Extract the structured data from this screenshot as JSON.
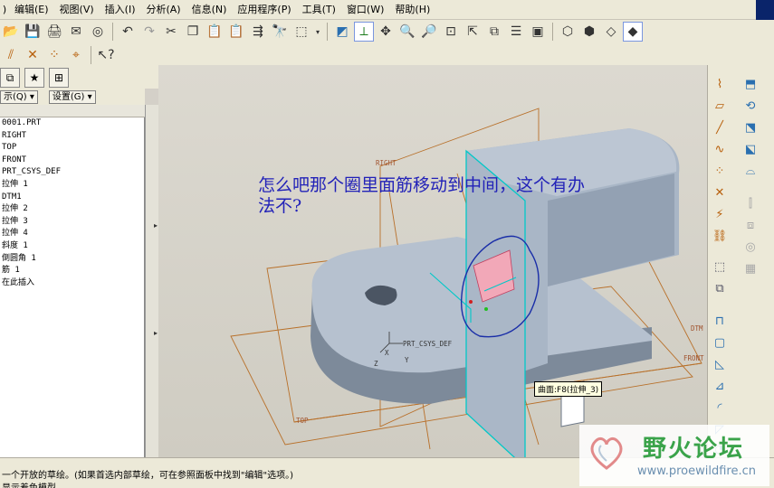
{
  "menu": {
    "left_edge": ")",
    "items": [
      "编辑(E)",
      "视图(V)",
      "插入(I)",
      "分析(A)",
      "信息(N)",
      "应用程序(P)",
      "工具(T)",
      "窗口(W)",
      "帮助(H)"
    ]
  },
  "toolbar": {
    "row1_icons": [
      "open-folder-icon",
      "save-icon",
      "print-icon",
      "send-icon",
      "model-icon",
      "cut-icon",
      "copy-icon",
      "paste-icon",
      "paste-special-icon",
      "regenerate-icon",
      "find-icon",
      "select-box-icon",
      "undo-icon",
      "redo-icon",
      "repaint-icon",
      "spin-center-icon",
      "orient-icon",
      "zoom-in-icon",
      "zoom-out-icon",
      "refit-icon",
      "reorient-icon",
      "saved-views-icon",
      "layers-icon",
      "view-manager-icon",
      "wireframe-icon",
      "hidden-line-icon",
      "no-hidden-icon",
      "shading-icon"
    ],
    "row2_icons": [
      "datum-plane-display-icon",
      "datum-axis-display-icon",
      "point-display-icon",
      "csys-display-icon",
      "whats-this-icon"
    ]
  },
  "navigator": {
    "show_label": "示(Q)",
    "settings_label": "设置(G)",
    "tree_items": [
      "0001.PRT",
      "RIGHT",
      "TOP",
      "FRONT",
      "PRT_CSYS_DEF",
      "拉伸 1",
      "DTM1",
      "拉伸 2",
      "拉伸 3",
      "拉伸 4",
      "斜度 1",
      "倒圆角 1",
      "筋 1",
      "在此插入"
    ]
  },
  "viewport": {
    "annotation": "怎么吧那个圈里面筋移动到中间，这个有办法不?",
    "tooltip": "曲面:F8(拉伸_3)",
    "datum_labels": {
      "right": "RIGHT",
      "top": "TOP",
      "front": "FRONT",
      "dtm": "DTM",
      "csys": "PRT_CSYS_DEF",
      "x": "X",
      "y": "Y",
      "z": "Z"
    }
  },
  "status": {
    "line1": "一个开放的草绘。(如果首选内部草绘，可在参照面板中找到\"编辑\"选项。)",
    "line2": "显示着色模型"
  },
  "watermark": {
    "title": "野火论坛",
    "url": "www.proewildfire.cn"
  },
  "colors": {
    "annotation": "#2222b8",
    "datum": "#a0522d",
    "model_body": "#a6b3c4",
    "selection_highlight": "#00c8c8",
    "sketch_circle": "#1a2ea8"
  }
}
